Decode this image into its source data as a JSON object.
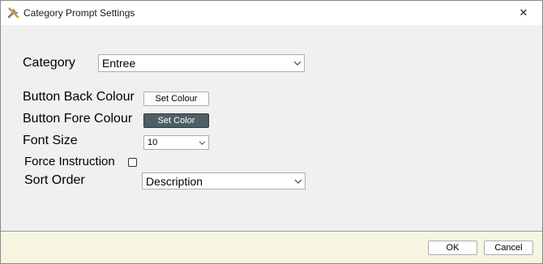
{
  "window": {
    "title": "Category Prompt Settings",
    "app_icon": "tools-icon",
    "close_glyph": "✕"
  },
  "form": {
    "category": {
      "label": "Category",
      "value": "Entree"
    },
    "button_back_colour": {
      "label": "Button Back Colour",
      "button_label": "Set Colour"
    },
    "button_fore_colour": {
      "label": "Button Fore Colour",
      "button_label": "Set Color",
      "swatch_color": "#4d5f66"
    },
    "font_size": {
      "label": "Font Size",
      "value": "10"
    },
    "force_instruction": {
      "label": "Force Instruction",
      "checked": false
    },
    "sort_order": {
      "label": "Sort Order",
      "value": "Description"
    }
  },
  "footer": {
    "ok_label": "OK",
    "cancel_label": "Cancel"
  }
}
